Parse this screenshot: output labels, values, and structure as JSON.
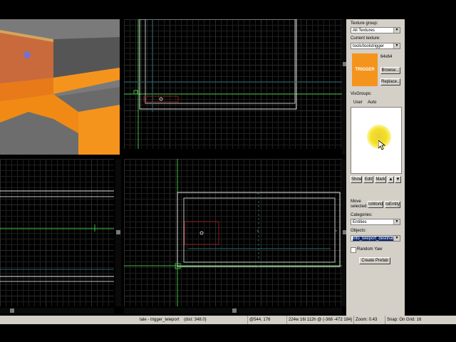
{
  "texture_panel": {
    "texture_group_label": "Texture group:",
    "texture_group_value": "All Textures",
    "current_texture_label": "Current texture:",
    "current_texture_value": "tools/toolstrigger",
    "texture_size": "64x64",
    "texture_preview_text": "TRIGGER",
    "browse_label": "Browse...",
    "replace_label": "Replace...",
    "texture_color": "#f5941d"
  },
  "visgroups": {
    "label": "VisGroups:",
    "tabs": [
      "User",
      "Auto"
    ],
    "buttons": {
      "show": "Show",
      "edit": "Edit",
      "mark": "Mark",
      "up": "▲",
      "down": "▼"
    }
  },
  "move_selected": {
    "label": "Move selected:",
    "to_world": "toWorld",
    "to_entity": "toEntity"
  },
  "categories": {
    "label": "Categories:",
    "value": "Entities"
  },
  "objects": {
    "label": "Objects:",
    "value": "info_teleport_destination"
  },
  "random_yaw_label": "Random Yaw",
  "create_prefab_label": "Create Prefab",
  "status": {
    "selection": "tale - trigger_teleport",
    "dist": "(dist: 348.0)",
    "coords": "@544, 176",
    "size": "224w 16l 112h @ (-368 -472 184)",
    "zoom": "Zoom: 0.43",
    "snap": "Snap: On Grid: 16"
  },
  "colors": {
    "orange": "#f5941d",
    "grid_line": "#1f1f1f",
    "selection_green": "#3fbf3f",
    "brush_white": "#e6e6e6",
    "trigger_red": "#8a1a1a",
    "panel_gray": "#d4d0c8"
  }
}
